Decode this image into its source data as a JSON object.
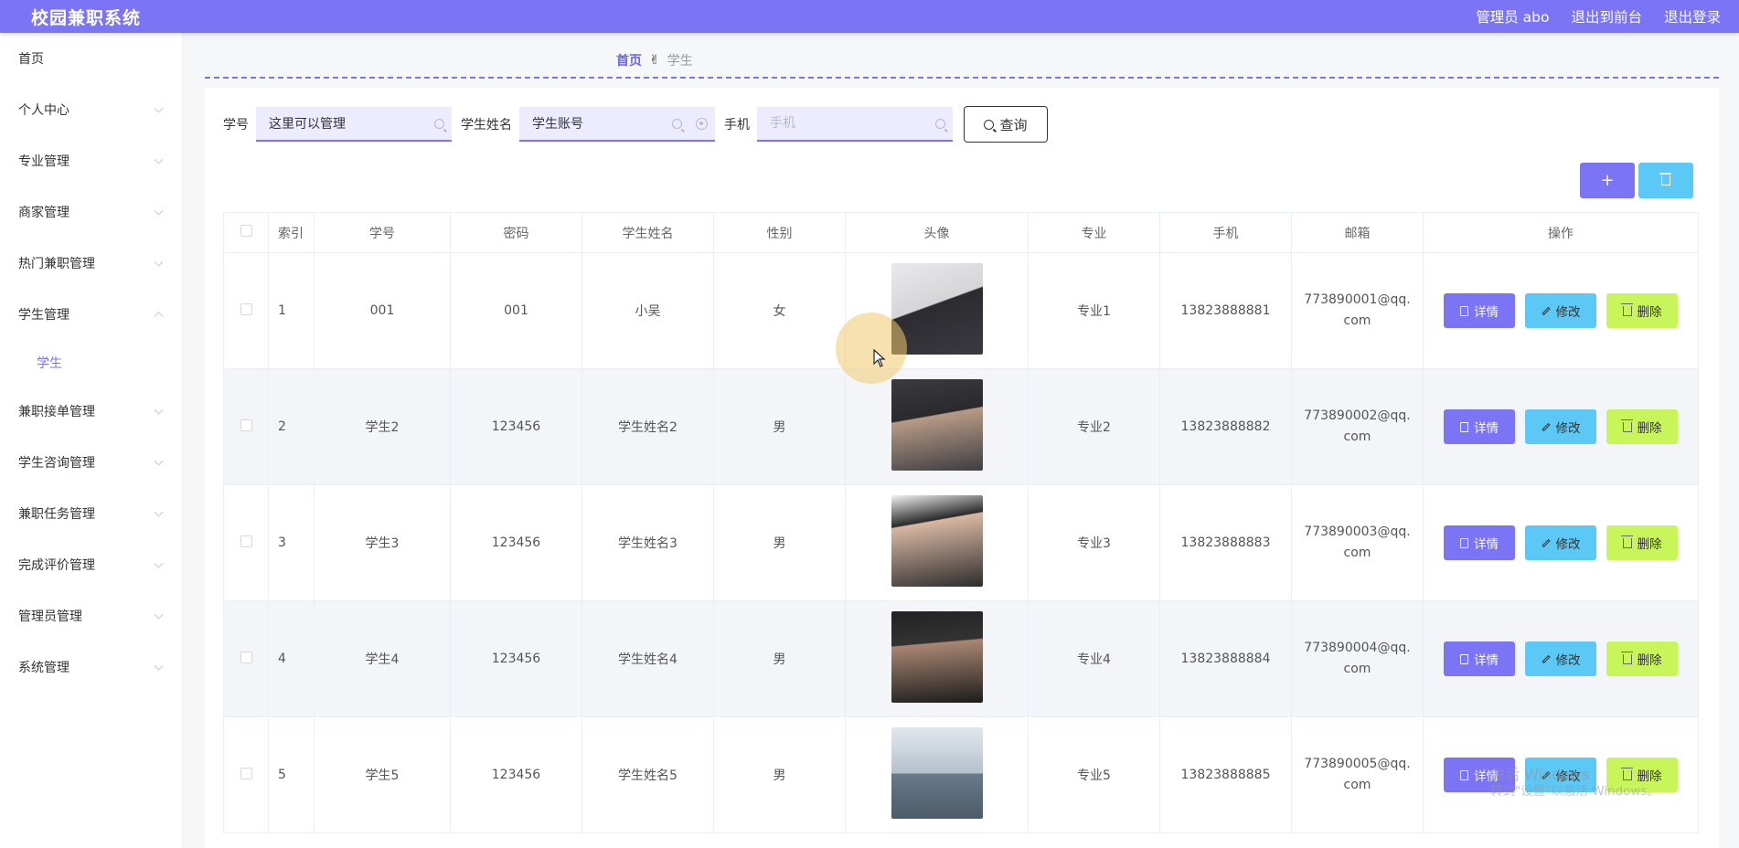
{
  "app": {
    "title": "校园兼职系统",
    "user": "管理员 abo",
    "exit_front": "退出到前台",
    "logout": "退出登录"
  },
  "sidebar": {
    "items": [
      {
        "label": "首页"
      },
      {
        "label": "个人中心"
      },
      {
        "label": "专业管理"
      },
      {
        "label": "商家管理"
      },
      {
        "label": "热门兼职管理"
      },
      {
        "label": "学生管理"
      },
      {
        "label": "兼职接单管理"
      },
      {
        "label": "学生咨询管理"
      },
      {
        "label": "兼职任务管理"
      },
      {
        "label": "完成评价管理"
      },
      {
        "label": "管理员管理"
      },
      {
        "label": "系统管理"
      }
    ],
    "active_sub": "学生"
  },
  "breadcrumb": {
    "home": "首页",
    "separator_emoji": "✌",
    "current": "学生"
  },
  "search": {
    "student_no_label": "学号",
    "student_no_value": "这里可以管理",
    "student_name_label": "学生姓名",
    "student_name_value": "学生账号",
    "phone_label": "手机",
    "phone_placeholder": "手机",
    "query_label": "查询"
  },
  "toolbar": {
    "add_label": "+"
  },
  "table": {
    "headers": {
      "index": "索引",
      "student_no": "学号",
      "password": "密码",
      "name": "学生姓名",
      "gender": "性别",
      "avatar": "头像",
      "major": "专业",
      "phone": "手机",
      "email": "邮箱",
      "actions": "操作"
    },
    "action_labels": {
      "detail": "详情",
      "edit": "修改",
      "delete": "删除"
    },
    "rows": [
      {
        "index": "1",
        "student_no": "001",
        "password": "001",
        "name": "小吴",
        "gender": "女",
        "major": "专业1",
        "phone": "13823888881",
        "email": "773890001@qq.com"
      },
      {
        "index": "2",
        "student_no": "学生2",
        "password": "123456",
        "name": "学生姓名2",
        "gender": "男",
        "major": "专业2",
        "phone": "13823888882",
        "email": "773890002@qq.com"
      },
      {
        "index": "3",
        "student_no": "学生3",
        "password": "123456",
        "name": "学生姓名3",
        "gender": "男",
        "major": "专业3",
        "phone": "13823888883",
        "email": "773890003@qq.com"
      },
      {
        "index": "4",
        "student_no": "学生4",
        "password": "123456",
        "name": "学生姓名4",
        "gender": "男",
        "major": "专业4",
        "phone": "13823888884",
        "email": "773890004@qq.com"
      },
      {
        "index": "5",
        "student_no": "学生5",
        "password": "123456",
        "name": "学生姓名5",
        "gender": "男",
        "major": "专业5",
        "phone": "13823888885",
        "email": "773890005@qq.com"
      }
    ]
  },
  "watermark": {
    "line1": "激活 Windows",
    "line2": "转到\"设置\"以激活 Windows。"
  },
  "colors": {
    "primary": "#7b74f5",
    "edit": "#5bc8f5",
    "delete": "#c8f55a"
  }
}
